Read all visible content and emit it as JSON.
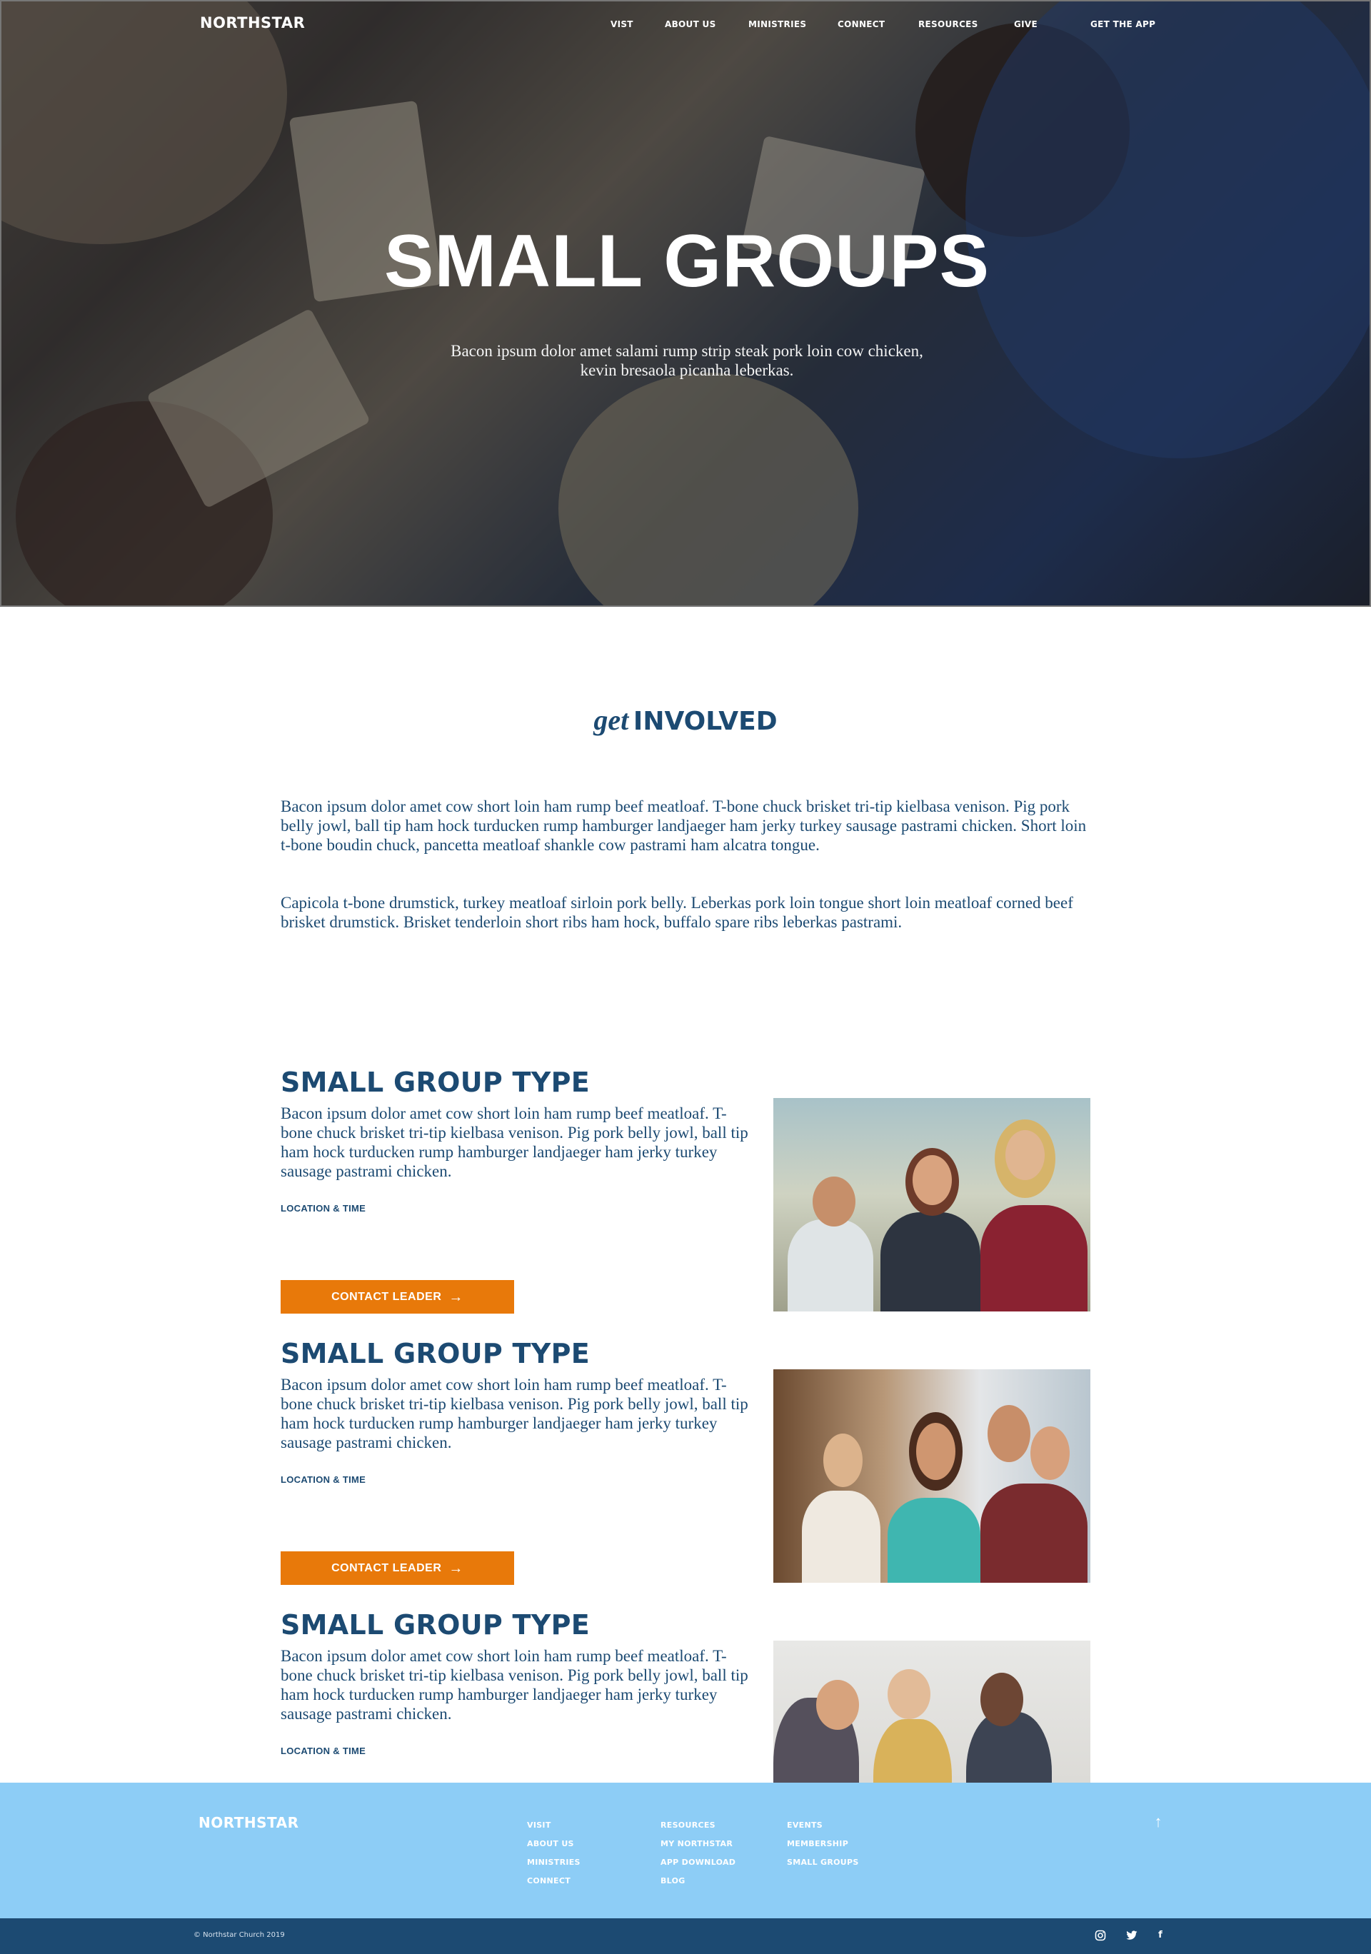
{
  "header": {
    "brand": "NORTHSTAR",
    "nav": [
      "VIST",
      "ABOUT US",
      "MINISTRIES",
      "CONNECT",
      "RESOURCES",
      "GIVE",
      "GET THE APP"
    ]
  },
  "hero": {
    "title": "SMALL GROUPS",
    "subtitle": "Bacon ipsum dolor amet salami rump strip steak pork loin cow chicken, kevin bresaola picanha leberkas."
  },
  "involved": {
    "title_script": "get",
    "title_main": "INVOLVED",
    "paragraphs": [
      "Bacon ipsum dolor amet cow short loin ham rump beef meatloaf. T-bone chuck brisket tri-tip kielbasa venison. Pig pork belly jowl, ball tip ham hock turducken rump hamburger landjaeger ham jerky turkey sausage pastrami chicken. Short loin t-bone boudin chuck, pancetta meatloaf shankle cow pastrami ham alcatra tongue.",
      "Capicola t-bone drumstick, turkey meatloaf sirloin pork belly. Leberkas pork loin tongue short loin meatloaf corned beef brisket drumstick. Brisket tenderloin short ribs ham hock, buffalo spare ribs leberkas pastrami."
    ]
  },
  "groups": [
    {
      "title": "SMALL GROUP TYPE",
      "description": "Bacon ipsum dolor amet cow short loin ham rump beef meatloaf. T-bone chuck brisket tri-tip kielbasa venison. Pig pork belly jowl, ball tip ham hock turducken rump hamburger landjaeger ham jerky turkey sausage pastrami chicken.",
      "location_label": "LOCATION & TIME",
      "button_label": "CONTACT LEADER"
    },
    {
      "title": "SMALL GROUP TYPE",
      "description": "Bacon ipsum dolor amet cow short loin ham rump beef meatloaf. T-bone chuck brisket tri-tip kielbasa venison. Pig pork belly jowl, ball tip ham hock turducken rump hamburger landjaeger ham jerky turkey sausage pastrami chicken.",
      "location_label": "LOCATION & TIME",
      "button_label": "CONTACT LEADER"
    },
    {
      "title": "SMALL GROUP TYPE",
      "description": "Bacon ipsum dolor amet cow short loin ham rump beef meatloaf. T-bone chuck brisket tri-tip kielbasa venison. Pig pork belly jowl, ball tip ham hock turducken rump hamburger landjaeger ham jerky turkey sausage pastrami chicken.",
      "location_label": "LOCATION & TIME"
    }
  ],
  "footer": {
    "brand": "NORTHSTAR",
    "col1": [
      "VISIT",
      "ABOUT US",
      "MINISTRIES",
      "CONNECT"
    ],
    "col2": [
      "RESOURCES",
      "MY NORTHSTAR",
      "APP DOWNLOAD",
      "BLOG"
    ],
    "col3": [
      "EVENTS",
      "MEMBERSHIP",
      "SMALL GROUPS"
    ],
    "copyright": "© Northstar Church 2019",
    "up_icon": "arrow-up-icon",
    "social_icons": [
      "instagram-icon",
      "twitter-icon",
      "facebook-icon"
    ]
  },
  "colors": {
    "primary": "#1c4a72",
    "accent": "#e8790a",
    "footer_bg": "#8dcdf6",
    "bottom_bar": "#1c4a72"
  }
}
